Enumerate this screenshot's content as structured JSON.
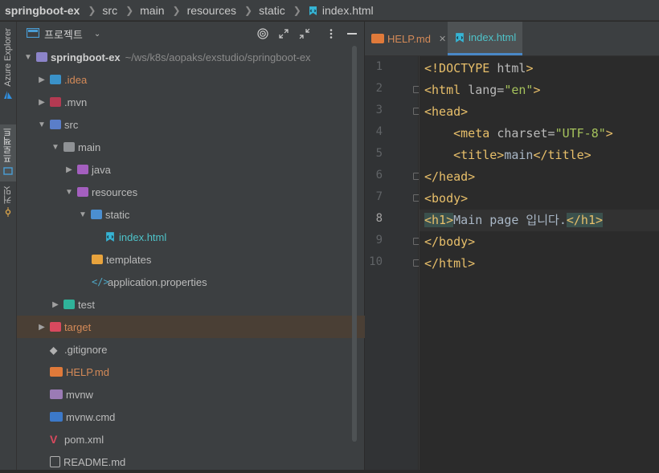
{
  "breadcrumb": {
    "root": "springboot-ex",
    "items": [
      "src",
      "main",
      "resources",
      "static"
    ],
    "file": "index.html"
  },
  "toolstrip": {
    "tabs": [
      {
        "label": "Azure Explorer",
        "icon": "azure-icon"
      },
      {
        "label": "프로젝트",
        "icon": "project-icon"
      },
      {
        "label": "커밋",
        "icon": "commit-icon"
      }
    ]
  },
  "project_panel": {
    "title": "프로젝트",
    "header_icons": [
      "target-icon",
      "expand-icon",
      "collapse-icon",
      "more-icon",
      "minimize-icon"
    ],
    "tree": [
      {
        "label": "springboot-ex",
        "path": "~/ws/k8s/aopaks/exstudio/springboot-ex",
        "icon": "module-folder-icon"
      },
      {
        "label": ".idea",
        "icon": "idea-folder-icon"
      },
      {
        "label": ".mvn",
        "icon": "mvn-folder-icon"
      },
      {
        "label": "src",
        "icon": "src-folder-icon"
      },
      {
        "label": "main",
        "icon": "folder-icon"
      },
      {
        "label": "java",
        "icon": "java-folder-icon"
      },
      {
        "label": "resources",
        "icon": "resources-folder-icon"
      },
      {
        "label": "static",
        "icon": "web-folder-icon"
      },
      {
        "label": "index.html",
        "icon": "html-file-icon"
      },
      {
        "label": "templates",
        "icon": "templates-folder-icon"
      },
      {
        "label": "application.properties",
        "icon": "properties-file-icon"
      },
      {
        "label": "test",
        "icon": "test-folder-icon"
      },
      {
        "label": "target",
        "icon": "excluded-folder-icon"
      },
      {
        "label": ".gitignore",
        "icon": "gitignore-icon"
      },
      {
        "label": "HELP.md",
        "icon": "markdown-icon"
      },
      {
        "label": "mvnw",
        "icon": "shell-icon"
      },
      {
        "label": "mvnw.cmd",
        "icon": "cmd-icon"
      },
      {
        "label": "pom.xml",
        "icon": "maven-icon"
      },
      {
        "label": "README.md",
        "icon": "readme-icon"
      }
    ]
  },
  "editor": {
    "tabs": [
      {
        "label": "HELP.md",
        "icon": "markdown-icon",
        "active": false
      },
      {
        "label": "index.html",
        "icon": "html-file-icon",
        "active": true
      }
    ],
    "current_line": 8,
    "line_numbers": [
      "1",
      "2",
      "3",
      "4",
      "5",
      "6",
      "7",
      "8",
      "9",
      "10"
    ]
  },
  "colors": {
    "tag": "#e8bf6a",
    "attr_value": "#a5c25c",
    "text": "#a9b7c6",
    "selection_row": "#4a3f35",
    "active_tab_underline": "#4a88c7"
  }
}
